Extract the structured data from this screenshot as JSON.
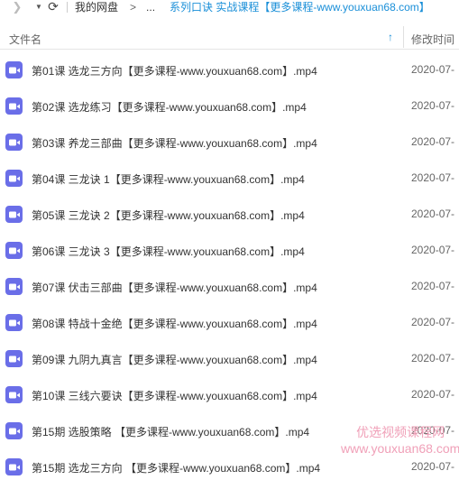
{
  "nav": {
    "back_icon": "chevron-right-icon",
    "dropdown_icon": "caret-down-icon",
    "refresh_icon": "refresh-icon"
  },
  "breadcrumb": {
    "root": "我的网盘",
    "arrow": ">",
    "more": "...",
    "current": "系列口诀 实战课程【更多课程-www.youxuan68.com】"
  },
  "header": {
    "name_col": "文件名",
    "sort_icon": "arrow-up-icon",
    "time_col": "修改时间"
  },
  "files": [
    {
      "name": "第01课 选龙三方向【更多课程-www.youxuan68.com】.mp4",
      "time": "2020-07-"
    },
    {
      "name": "第02课 选龙练习【更多课程-www.youxuan68.com】.mp4",
      "time": "2020-07-"
    },
    {
      "name": "第03课 养龙三部曲【更多课程-www.youxuan68.com】.mp4",
      "time": "2020-07-"
    },
    {
      "name": "第04课 三龙诀 1【更多课程-www.youxuan68.com】.mp4",
      "time": "2020-07-"
    },
    {
      "name": "第05课 三龙诀 2【更多课程-www.youxuan68.com】.mp4",
      "time": "2020-07-"
    },
    {
      "name": "第06课 三龙诀 3【更多课程-www.youxuan68.com】.mp4",
      "time": "2020-07-"
    },
    {
      "name": "第07课 伏击三部曲【更多课程-www.youxuan68.com】.mp4",
      "time": "2020-07-"
    },
    {
      "name": "第08课 特战十金绝【更多课程-www.youxuan68.com】.mp4",
      "time": "2020-07-"
    },
    {
      "name": "第09课 九阴九真言【更多课程-www.youxuan68.com】.mp4",
      "time": "2020-07-"
    },
    {
      "name": "第10课 三线六要诀【更多课程-www.youxuan68.com】.mp4",
      "time": "2020-07-"
    },
    {
      "name": "第15期 选股策略 【更多课程-www.youxuan68.com】.mp4",
      "time": "2020-07-"
    },
    {
      "name": "第15期 选龙三方向 【更多课程-www.youxuan68.com】.mp4",
      "time": "2020-07-"
    }
  ],
  "file_icon": "video-file-icon",
  "colors": {
    "icon_bg": "#6a6ee8",
    "link": "#1a8fd8",
    "watermark": "#f0a0b8"
  },
  "watermark": {
    "line1": "优选视频课程网",
    "line2": "www.youxuan68.com"
  }
}
